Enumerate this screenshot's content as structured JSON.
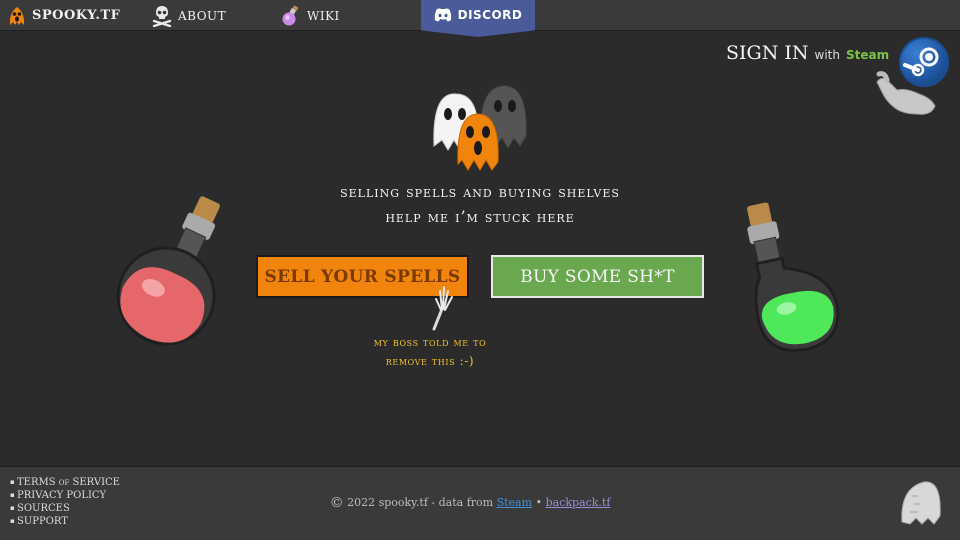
{
  "nav": {
    "brand": "SPOOKY.TF",
    "about": "ABOUT",
    "wiki": "WIKI",
    "discord": "DISCORD"
  },
  "signin": {
    "label": "SIGN IN",
    "with": "with",
    "provider": "Steam"
  },
  "hero": {
    "tagline_1": "selling spells and buying shelves",
    "tagline_2": "help me i’m stuck here",
    "sell_button": "SELL YOUR SPELLS",
    "buy_button": "BUY SOME SH*T",
    "note_1": "my boss told me to",
    "note_2": "remove this :-)"
  },
  "footer": {
    "links": [
      "TERMS of SERVICE",
      "PRIVACY POLICY",
      "SOURCES",
      "SUPPORT"
    ],
    "copyright_symbol": "©",
    "copyright_text": "2022  spooky.tf - data from",
    "steam_link": "Steam",
    "separator": "•",
    "backpack_link": "backpack.tf"
  },
  "colors": {
    "background": "#2b2b2b",
    "bar": "#3a3a3a",
    "sell": "#f0840c",
    "buy": "#6aa84f",
    "discord": "#4a5a9a",
    "note": "#f2c230",
    "steam_green": "#7cc447"
  },
  "icons": {
    "brand": "pumpkin-ghost-icon",
    "about": "skull-crossbones-icon",
    "wiki": "potion-bottle-icon",
    "discord": "discord-logo-icon",
    "steam": "steam-logo-icon"
  }
}
